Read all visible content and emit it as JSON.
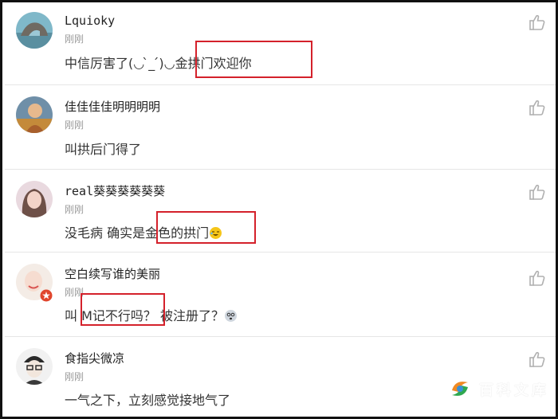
{
  "comments": [
    {
      "username": "Lquioky",
      "time": "刚刚",
      "text_before": "中信厉害了(◡ ̀_ ́)◡",
      "text_highlight": "金拱门欢迎你",
      "text_after": ""
    },
    {
      "username": "佳佳佳佳明明明明",
      "time": "刚刚",
      "text_before": "叫拱后门得了",
      "text_highlight": "",
      "text_after": ""
    },
    {
      "username": "real葵葵葵葵葵葵",
      "time": "刚刚",
      "text_before": "没毛病 确实是",
      "text_highlight": "金色的拱门",
      "text_after": ""
    },
    {
      "username": "空白续写谁的美丽",
      "time": "刚刚",
      "text_before": "叫 ",
      "text_highlight": "M记不行吗？",
      "text_after": " 被注册了？"
    },
    {
      "username": "食指尖微凉",
      "time": "刚刚",
      "text_before": "一气之下，立刻感觉接地气了",
      "text_highlight": "",
      "text_after": ""
    }
  ],
  "icons": {
    "like": "thumbs-up-icon",
    "emoji_laugh": "laugh-emoji-icon",
    "emoji_dizzy": "dizzy-emoji-icon",
    "badge": "star-badge-icon",
    "watermark_logo": "watermark-logo-icon"
  },
  "watermark": {
    "text": "百科文库"
  },
  "colors": {
    "highlight_box": "#d4212b",
    "time": "#9a9a9a",
    "text": "#333333",
    "divider": "#e6e6e6"
  }
}
